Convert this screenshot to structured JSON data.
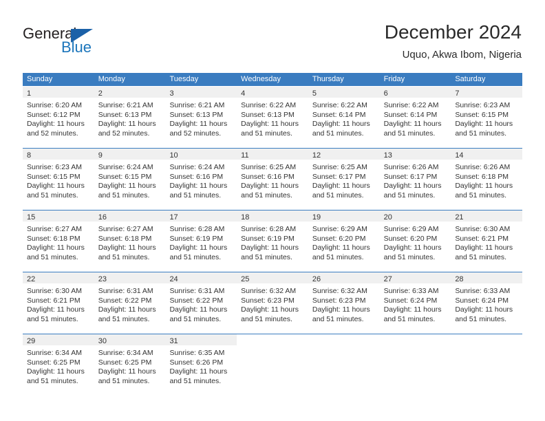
{
  "logo": {
    "word_one": "General",
    "word_two": "Blue",
    "triangle_color": "#1b61a8",
    "blue_color": "#1b75bb"
  },
  "header": {
    "title": "December 2024",
    "subtitle": "Uquo, Akwa Ibom, Nigeria"
  },
  "theme": {
    "header_blue": "#3a7cc0",
    "daynum_band": "#f0f0f0",
    "text": "#333333"
  },
  "weekdays": [
    "Sunday",
    "Monday",
    "Tuesday",
    "Wednesday",
    "Thursday",
    "Friday",
    "Saturday"
  ],
  "weeks": [
    [
      {
        "day": "1",
        "sunrise": "Sunrise: 6:20 AM",
        "sunset": "Sunset: 6:12 PM",
        "daylight1": "Daylight: 11 hours",
        "daylight2": "and 52 minutes."
      },
      {
        "day": "2",
        "sunrise": "Sunrise: 6:21 AM",
        "sunset": "Sunset: 6:13 PM",
        "daylight1": "Daylight: 11 hours",
        "daylight2": "and 52 minutes."
      },
      {
        "day": "3",
        "sunrise": "Sunrise: 6:21 AM",
        "sunset": "Sunset: 6:13 PM",
        "daylight1": "Daylight: 11 hours",
        "daylight2": "and 52 minutes."
      },
      {
        "day": "4",
        "sunrise": "Sunrise: 6:22 AM",
        "sunset": "Sunset: 6:13 PM",
        "daylight1": "Daylight: 11 hours",
        "daylight2": "and 51 minutes."
      },
      {
        "day": "5",
        "sunrise": "Sunrise: 6:22 AM",
        "sunset": "Sunset: 6:14 PM",
        "daylight1": "Daylight: 11 hours",
        "daylight2": "and 51 minutes."
      },
      {
        "day": "6",
        "sunrise": "Sunrise: 6:22 AM",
        "sunset": "Sunset: 6:14 PM",
        "daylight1": "Daylight: 11 hours",
        "daylight2": "and 51 minutes."
      },
      {
        "day": "7",
        "sunrise": "Sunrise: 6:23 AM",
        "sunset": "Sunset: 6:15 PM",
        "daylight1": "Daylight: 11 hours",
        "daylight2": "and 51 minutes."
      }
    ],
    [
      {
        "day": "8",
        "sunrise": "Sunrise: 6:23 AM",
        "sunset": "Sunset: 6:15 PM",
        "daylight1": "Daylight: 11 hours",
        "daylight2": "and 51 minutes."
      },
      {
        "day": "9",
        "sunrise": "Sunrise: 6:24 AM",
        "sunset": "Sunset: 6:15 PM",
        "daylight1": "Daylight: 11 hours",
        "daylight2": "and 51 minutes."
      },
      {
        "day": "10",
        "sunrise": "Sunrise: 6:24 AM",
        "sunset": "Sunset: 6:16 PM",
        "daylight1": "Daylight: 11 hours",
        "daylight2": "and 51 minutes."
      },
      {
        "day": "11",
        "sunrise": "Sunrise: 6:25 AM",
        "sunset": "Sunset: 6:16 PM",
        "daylight1": "Daylight: 11 hours",
        "daylight2": "and 51 minutes."
      },
      {
        "day": "12",
        "sunrise": "Sunrise: 6:25 AM",
        "sunset": "Sunset: 6:17 PM",
        "daylight1": "Daylight: 11 hours",
        "daylight2": "and 51 minutes."
      },
      {
        "day": "13",
        "sunrise": "Sunrise: 6:26 AM",
        "sunset": "Sunset: 6:17 PM",
        "daylight1": "Daylight: 11 hours",
        "daylight2": "and 51 minutes."
      },
      {
        "day": "14",
        "sunrise": "Sunrise: 6:26 AM",
        "sunset": "Sunset: 6:18 PM",
        "daylight1": "Daylight: 11 hours",
        "daylight2": "and 51 minutes."
      }
    ],
    [
      {
        "day": "15",
        "sunrise": "Sunrise: 6:27 AM",
        "sunset": "Sunset: 6:18 PM",
        "daylight1": "Daylight: 11 hours",
        "daylight2": "and 51 minutes."
      },
      {
        "day": "16",
        "sunrise": "Sunrise: 6:27 AM",
        "sunset": "Sunset: 6:18 PM",
        "daylight1": "Daylight: 11 hours",
        "daylight2": "and 51 minutes."
      },
      {
        "day": "17",
        "sunrise": "Sunrise: 6:28 AM",
        "sunset": "Sunset: 6:19 PM",
        "daylight1": "Daylight: 11 hours",
        "daylight2": "and 51 minutes."
      },
      {
        "day": "18",
        "sunrise": "Sunrise: 6:28 AM",
        "sunset": "Sunset: 6:19 PM",
        "daylight1": "Daylight: 11 hours",
        "daylight2": "and 51 minutes."
      },
      {
        "day": "19",
        "sunrise": "Sunrise: 6:29 AM",
        "sunset": "Sunset: 6:20 PM",
        "daylight1": "Daylight: 11 hours",
        "daylight2": "and 51 minutes."
      },
      {
        "day": "20",
        "sunrise": "Sunrise: 6:29 AM",
        "sunset": "Sunset: 6:20 PM",
        "daylight1": "Daylight: 11 hours",
        "daylight2": "and 51 minutes."
      },
      {
        "day": "21",
        "sunrise": "Sunrise: 6:30 AM",
        "sunset": "Sunset: 6:21 PM",
        "daylight1": "Daylight: 11 hours",
        "daylight2": "and 51 minutes."
      }
    ],
    [
      {
        "day": "22",
        "sunrise": "Sunrise: 6:30 AM",
        "sunset": "Sunset: 6:21 PM",
        "daylight1": "Daylight: 11 hours",
        "daylight2": "and 51 minutes."
      },
      {
        "day": "23",
        "sunrise": "Sunrise: 6:31 AM",
        "sunset": "Sunset: 6:22 PM",
        "daylight1": "Daylight: 11 hours",
        "daylight2": "and 51 minutes."
      },
      {
        "day": "24",
        "sunrise": "Sunrise: 6:31 AM",
        "sunset": "Sunset: 6:22 PM",
        "daylight1": "Daylight: 11 hours",
        "daylight2": "and 51 minutes."
      },
      {
        "day": "25",
        "sunrise": "Sunrise: 6:32 AM",
        "sunset": "Sunset: 6:23 PM",
        "daylight1": "Daylight: 11 hours",
        "daylight2": "and 51 minutes."
      },
      {
        "day": "26",
        "sunrise": "Sunrise: 6:32 AM",
        "sunset": "Sunset: 6:23 PM",
        "daylight1": "Daylight: 11 hours",
        "daylight2": "and 51 minutes."
      },
      {
        "day": "27",
        "sunrise": "Sunrise: 6:33 AM",
        "sunset": "Sunset: 6:24 PM",
        "daylight1": "Daylight: 11 hours",
        "daylight2": "and 51 minutes."
      },
      {
        "day": "28",
        "sunrise": "Sunrise: 6:33 AM",
        "sunset": "Sunset: 6:24 PM",
        "daylight1": "Daylight: 11 hours",
        "daylight2": "and 51 minutes."
      }
    ],
    [
      {
        "day": "29",
        "sunrise": "Sunrise: 6:34 AM",
        "sunset": "Sunset: 6:25 PM",
        "daylight1": "Daylight: 11 hours",
        "daylight2": "and 51 minutes."
      },
      {
        "day": "30",
        "sunrise": "Sunrise: 6:34 AM",
        "sunset": "Sunset: 6:25 PM",
        "daylight1": "Daylight: 11 hours",
        "daylight2": "and 51 minutes."
      },
      {
        "day": "31",
        "sunrise": "Sunrise: 6:35 AM",
        "sunset": "Sunset: 6:26 PM",
        "daylight1": "Daylight: 11 hours",
        "daylight2": "and 51 minutes."
      },
      {
        "day": "",
        "sunrise": "",
        "sunset": "",
        "daylight1": "",
        "daylight2": ""
      },
      {
        "day": "",
        "sunrise": "",
        "sunset": "",
        "daylight1": "",
        "daylight2": ""
      },
      {
        "day": "",
        "sunrise": "",
        "sunset": "",
        "daylight1": "",
        "daylight2": ""
      },
      {
        "day": "",
        "sunrise": "",
        "sunset": "",
        "daylight1": "",
        "daylight2": ""
      }
    ]
  ]
}
